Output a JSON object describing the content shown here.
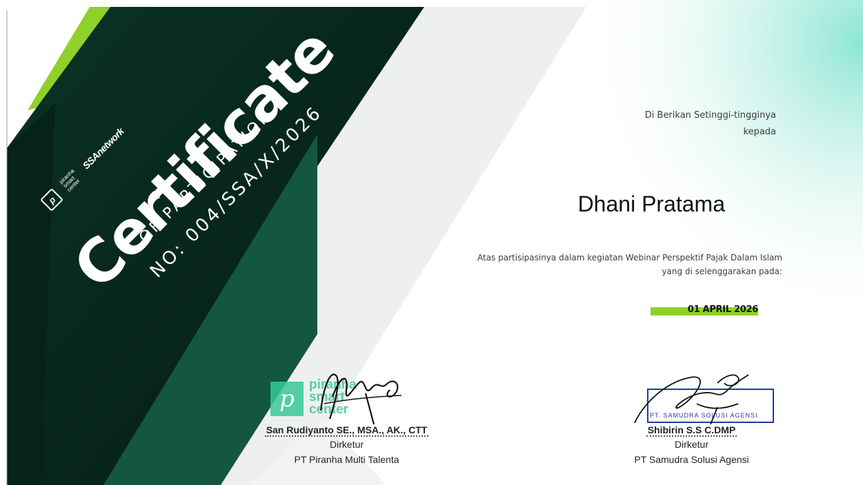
{
  "certificate": {
    "logos": {
      "piranha_mark": "p",
      "piranha_text": [
        "piranha",
        "smart",
        "center"
      ],
      "ssa_text": "SSAnetwork"
    },
    "title": "Certificate",
    "subtitle": "OF PARTICIPATION",
    "number": "NO: 004/SSA/X/2026",
    "given_line1": "Di Berikan Setinggi-tingginya",
    "given_line2": "kepada",
    "recipient": "Dhani Pratama",
    "description_line1": "Atas partisipasinya dalam kegiatan Webinar Perspektif Pajak Dalam Islam",
    "description_line2": "yang di selenggarakan pada:",
    "date": "01 APRIL 2026",
    "colors": {
      "dark_green": "#07261c",
      "mid_green": "#14573f",
      "lime": "#8fd12a",
      "stamp_green": "#39c99a",
      "stamp_blue": "#1e3f9a"
    }
  },
  "signatories": [
    {
      "name": "San Rudiyanto SE., MSA., AK., CTT",
      "role": "Dirketur",
      "company": "PT Piranha Multi Talenta",
      "stamp_mark": "p",
      "stamp_text": [
        "piranha",
        "smart",
        "center"
      ]
    },
    {
      "name": "Shibirin S.S C.DMP",
      "role": "Dirketur",
      "company": "PT Samudra Solusi Agensi",
      "stamp_text": "PT. SAMUDRA SOLUSI AGENSI"
    }
  ]
}
